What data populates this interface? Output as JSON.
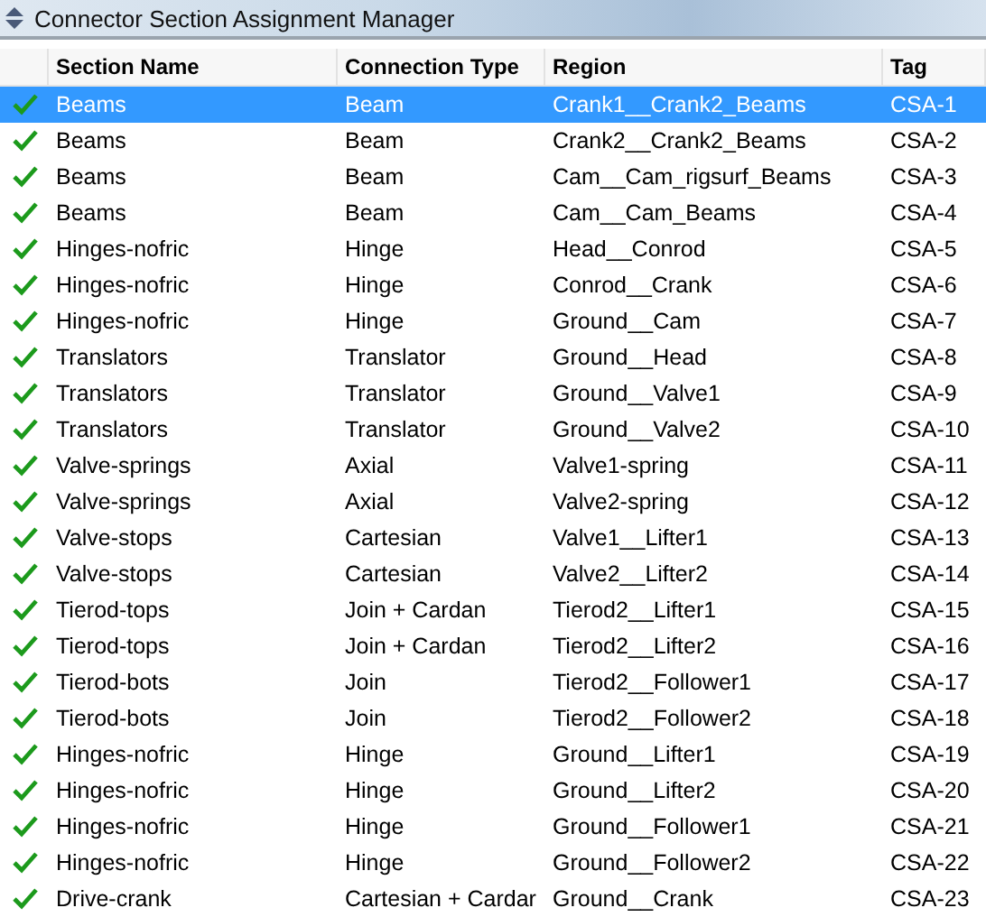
{
  "window": {
    "title": "Connector Section Assignment Manager"
  },
  "table": {
    "columns": [
      "Section Name",
      "Connection Type",
      "Region",
      "Tag"
    ],
    "rows": [
      {
        "checked": true,
        "selected": true,
        "cells": [
          "Beams",
          "Beam",
          "Crank1__Crank2_Beams",
          "CSA-1"
        ]
      },
      {
        "checked": true,
        "selected": false,
        "cells": [
          "Beams",
          "Beam",
          "Crank2__Crank2_Beams",
          "CSA-2"
        ]
      },
      {
        "checked": true,
        "selected": false,
        "cells": [
          "Beams",
          "Beam",
          "Cam__Cam_rigsurf_Beams",
          "CSA-3"
        ]
      },
      {
        "checked": true,
        "selected": false,
        "cells": [
          "Beams",
          "Beam",
          "Cam__Cam_Beams",
          "CSA-4"
        ]
      },
      {
        "checked": true,
        "selected": false,
        "cells": [
          "Hinges-nofric",
          "Hinge",
          "Head__Conrod",
          "CSA-5"
        ]
      },
      {
        "checked": true,
        "selected": false,
        "cells": [
          "Hinges-nofric",
          "Hinge",
          "Conrod__Crank",
          "CSA-6"
        ]
      },
      {
        "checked": true,
        "selected": false,
        "cells": [
          "Hinges-nofric",
          "Hinge",
          "Ground__Cam",
          "CSA-7"
        ]
      },
      {
        "checked": true,
        "selected": false,
        "cells": [
          "Translators",
          "Translator",
          "Ground__Head",
          "CSA-8"
        ]
      },
      {
        "checked": true,
        "selected": false,
        "cells": [
          "Translators",
          "Translator",
          "Ground__Valve1",
          "CSA-9"
        ]
      },
      {
        "checked": true,
        "selected": false,
        "cells": [
          "Translators",
          "Translator",
          "Ground__Valve2",
          "CSA-10"
        ]
      },
      {
        "checked": true,
        "selected": false,
        "cells": [
          "Valve-springs",
          "Axial",
          "Valve1-spring",
          "CSA-11"
        ]
      },
      {
        "checked": true,
        "selected": false,
        "cells": [
          "Valve-springs",
          "Axial",
          "Valve2-spring",
          "CSA-12"
        ]
      },
      {
        "checked": true,
        "selected": false,
        "cells": [
          "Valve-stops",
          "Cartesian",
          "Valve1__Lifter1",
          "CSA-13"
        ]
      },
      {
        "checked": true,
        "selected": false,
        "cells": [
          "Valve-stops",
          "Cartesian",
          "Valve2__Lifter2",
          "CSA-14"
        ]
      },
      {
        "checked": true,
        "selected": false,
        "cells": [
          "Tierod-tops",
          "Join + Cardan",
          "Tierod2__Lifter1",
          "CSA-15"
        ]
      },
      {
        "checked": true,
        "selected": false,
        "cells": [
          "Tierod-tops",
          "Join + Cardan",
          "Tierod2__Lifter2",
          "CSA-16"
        ]
      },
      {
        "checked": true,
        "selected": false,
        "cells": [
          "Tierod-bots",
          "Join",
          "Tierod2__Follower1",
          "CSA-17"
        ]
      },
      {
        "checked": true,
        "selected": false,
        "cells": [
          "Tierod-bots",
          "Join",
          "Tierod2__Follower2",
          "CSA-18"
        ]
      },
      {
        "checked": true,
        "selected": false,
        "cells": [
          "Hinges-nofric",
          "Hinge",
          "Ground__Lifter1",
          "CSA-19"
        ]
      },
      {
        "checked": true,
        "selected": false,
        "cells": [
          "Hinges-nofric",
          "Hinge",
          "Ground__Lifter2",
          "CSA-20"
        ]
      },
      {
        "checked": true,
        "selected": false,
        "cells": [
          "Hinges-nofric",
          "Hinge",
          "Ground__Follower1",
          "CSA-21"
        ]
      },
      {
        "checked": true,
        "selected": false,
        "cells": [
          "Hinges-nofric",
          "Hinge",
          "Ground__Follower2",
          "CSA-22"
        ]
      },
      {
        "checked": true,
        "selected": false,
        "cells": [
          "Drive-crank",
          "Cartesian + Cardar",
          "Ground__Crank",
          "CSA-23"
        ]
      }
    ]
  }
}
